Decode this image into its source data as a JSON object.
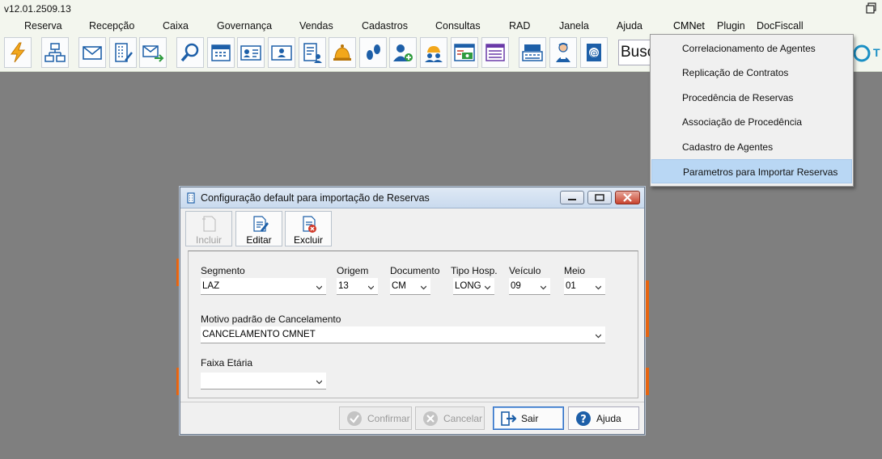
{
  "app": {
    "version": "v12.01.2509.13"
  },
  "menu": {
    "items": [
      "Reserva",
      "Recepção",
      "Caixa",
      "Governança",
      "Vendas",
      "Cadastros",
      "Consultas",
      "RAD",
      "Janela",
      "Ajuda",
      "CMNet",
      "Plugin",
      "DocFiscall"
    ],
    "active": "CMNet"
  },
  "toolbar": {
    "icons": [
      "lightning-icon",
      "org-chart-icon",
      "mail-icon",
      "building-icon",
      "mail-forward-icon",
      "search-icon",
      "calendar-icon",
      "id-card-icon",
      "id-card-2-icon",
      "checklist-user-icon",
      "bell-icon",
      "footprints-icon",
      "add-user-icon",
      "group-icon",
      "money-window-icon",
      "list-window-icon",
      "register-icon",
      "housekeeper-icon",
      "at-book-icon"
    ],
    "search_value": "Busc",
    "right_logo_letter": "T"
  },
  "cmnet_menu": {
    "items": [
      "Correlacionamento de Agentes",
      "Replicação de Contratos",
      "Procedência de Reservas",
      "Associação de Procedência",
      "Cadastro de Agentes",
      "Parametros para Importar Reservas"
    ],
    "selected": "Parametros para Importar Reservas"
  },
  "dialog": {
    "title": "Configuração default para importação de Reservas",
    "toolbar": {
      "incluir": "Incluir",
      "editar": "Editar",
      "excluir": "Excluir"
    },
    "fields": {
      "segmento": {
        "label": "Segmento",
        "value": "LAZ"
      },
      "origem": {
        "label": "Origem",
        "value": "13"
      },
      "documento": {
        "label": "Documento",
        "value": "CM"
      },
      "tipo_hosp": {
        "label": "Tipo Hosp.",
        "value": "LONG"
      },
      "veiculo": {
        "label": "Veículo",
        "value": "09"
      },
      "meio": {
        "label": "Meio",
        "value": "01"
      },
      "motivo": {
        "label": "Motivo padrão de Cancelamento",
        "value": "CANCELAMENTO CMNET"
      },
      "faixa": {
        "label": "Faixa Etária",
        "value": ""
      }
    },
    "footer": {
      "confirmar": "Confirmar",
      "cancelar": "Cancelar",
      "sair": "Sair",
      "ajuda": "Ajuda"
    }
  }
}
